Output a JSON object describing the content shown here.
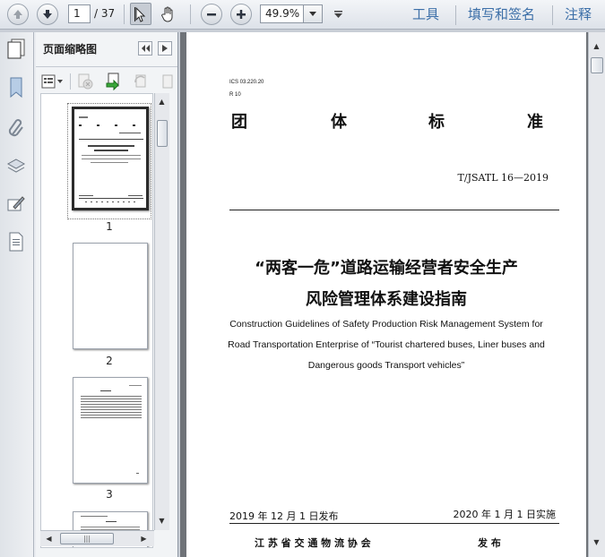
{
  "toolbar": {
    "page_current": "1",
    "page_total": "/ 37",
    "zoom": "49.9%",
    "right_links": [
      "工具",
      "填写和签名",
      "注释"
    ]
  },
  "sidebar": {
    "panel_title": "页面缩略图",
    "thumbnails": [
      {
        "label": "1"
      },
      {
        "label": "2"
      },
      {
        "label": "3"
      }
    ]
  },
  "document": {
    "ics": "ICS 03.220.20",
    "r": "R 10",
    "title_chars": [
      "团",
      "体",
      "标",
      "准"
    ],
    "code": "T/JSATL 16—2019",
    "title_cn_line1": "“两客一危”道路运输经营者安全生产",
    "title_cn_line2": "风险管理体系建设指南",
    "title_en_line1": "Construction Guidelines of Safety Production Risk Management System for",
    "title_en_line2": "Road Transportation Enterprise of “Tourist chartered buses, Liner buses and",
    "title_en_line3": "Dangerous goods Transport vehicles”",
    "publish_date": "2019 年 12 月 1 日发布",
    "implement_date": "2020 年 1 月 1 日实施",
    "issuer": "江 苏 省 交 通 物 流 协 会",
    "issue_word": "发 布"
  },
  "colors": {
    "accent_link": "#3c6fa8",
    "viewer_bg": "#6f7378"
  }
}
